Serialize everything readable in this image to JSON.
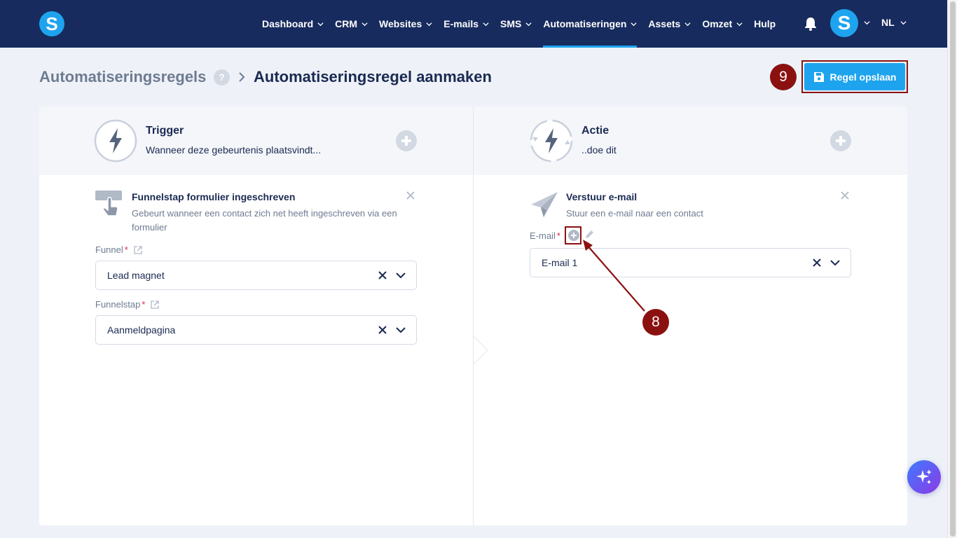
{
  "nav": {
    "logo": "S",
    "items": [
      {
        "label": "Dashboard",
        "has_menu": true
      },
      {
        "label": "CRM",
        "has_menu": true
      },
      {
        "label": "Websites",
        "has_menu": true
      },
      {
        "label": "E-mails",
        "has_menu": true
      },
      {
        "label": "SMS",
        "has_menu": true
      },
      {
        "label": "Automatiseringen",
        "has_menu": true,
        "active": true
      },
      {
        "label": "Assets",
        "has_menu": true
      },
      {
        "label": "Omzet",
        "has_menu": true
      },
      {
        "label": "Hulp",
        "has_menu": false
      }
    ],
    "avatar": "S",
    "language": "NL"
  },
  "breadcrumb": {
    "parent": "Automatiseringsregels",
    "help": "?",
    "current": "Automatiseringsregel aanmaken"
  },
  "save": {
    "label": "Regel opslaan",
    "step_badge": "9"
  },
  "trigger": {
    "title": "Trigger",
    "subtitle": "Wanneer deze gebeurtenis plaatsvindt...",
    "card": {
      "title": "Funnelstap formulier ingeschreven",
      "description": "Gebeurt wanneer een contact zich net heeft ingeschreven via een formulier"
    },
    "fields": [
      {
        "label": "Funnel",
        "required": "*",
        "value": "Lead magnet"
      },
      {
        "label": "Funnelstap",
        "required": "*",
        "value": "Aanmeldpagina"
      }
    ]
  },
  "action": {
    "title": "Actie",
    "subtitle": "..doe dit",
    "card": {
      "title": "Verstuur e-mail",
      "description": "Stuur een e-mail naar een contact"
    },
    "field": {
      "label": "E-mail",
      "required": "*",
      "value": "E-mail 1"
    },
    "step_badge": "8"
  },
  "colors": {
    "nav_bg": "#172b5e",
    "accent": "#1ea4ef",
    "annotation": "#8b1111",
    "page_bg": "#eef2f8"
  }
}
